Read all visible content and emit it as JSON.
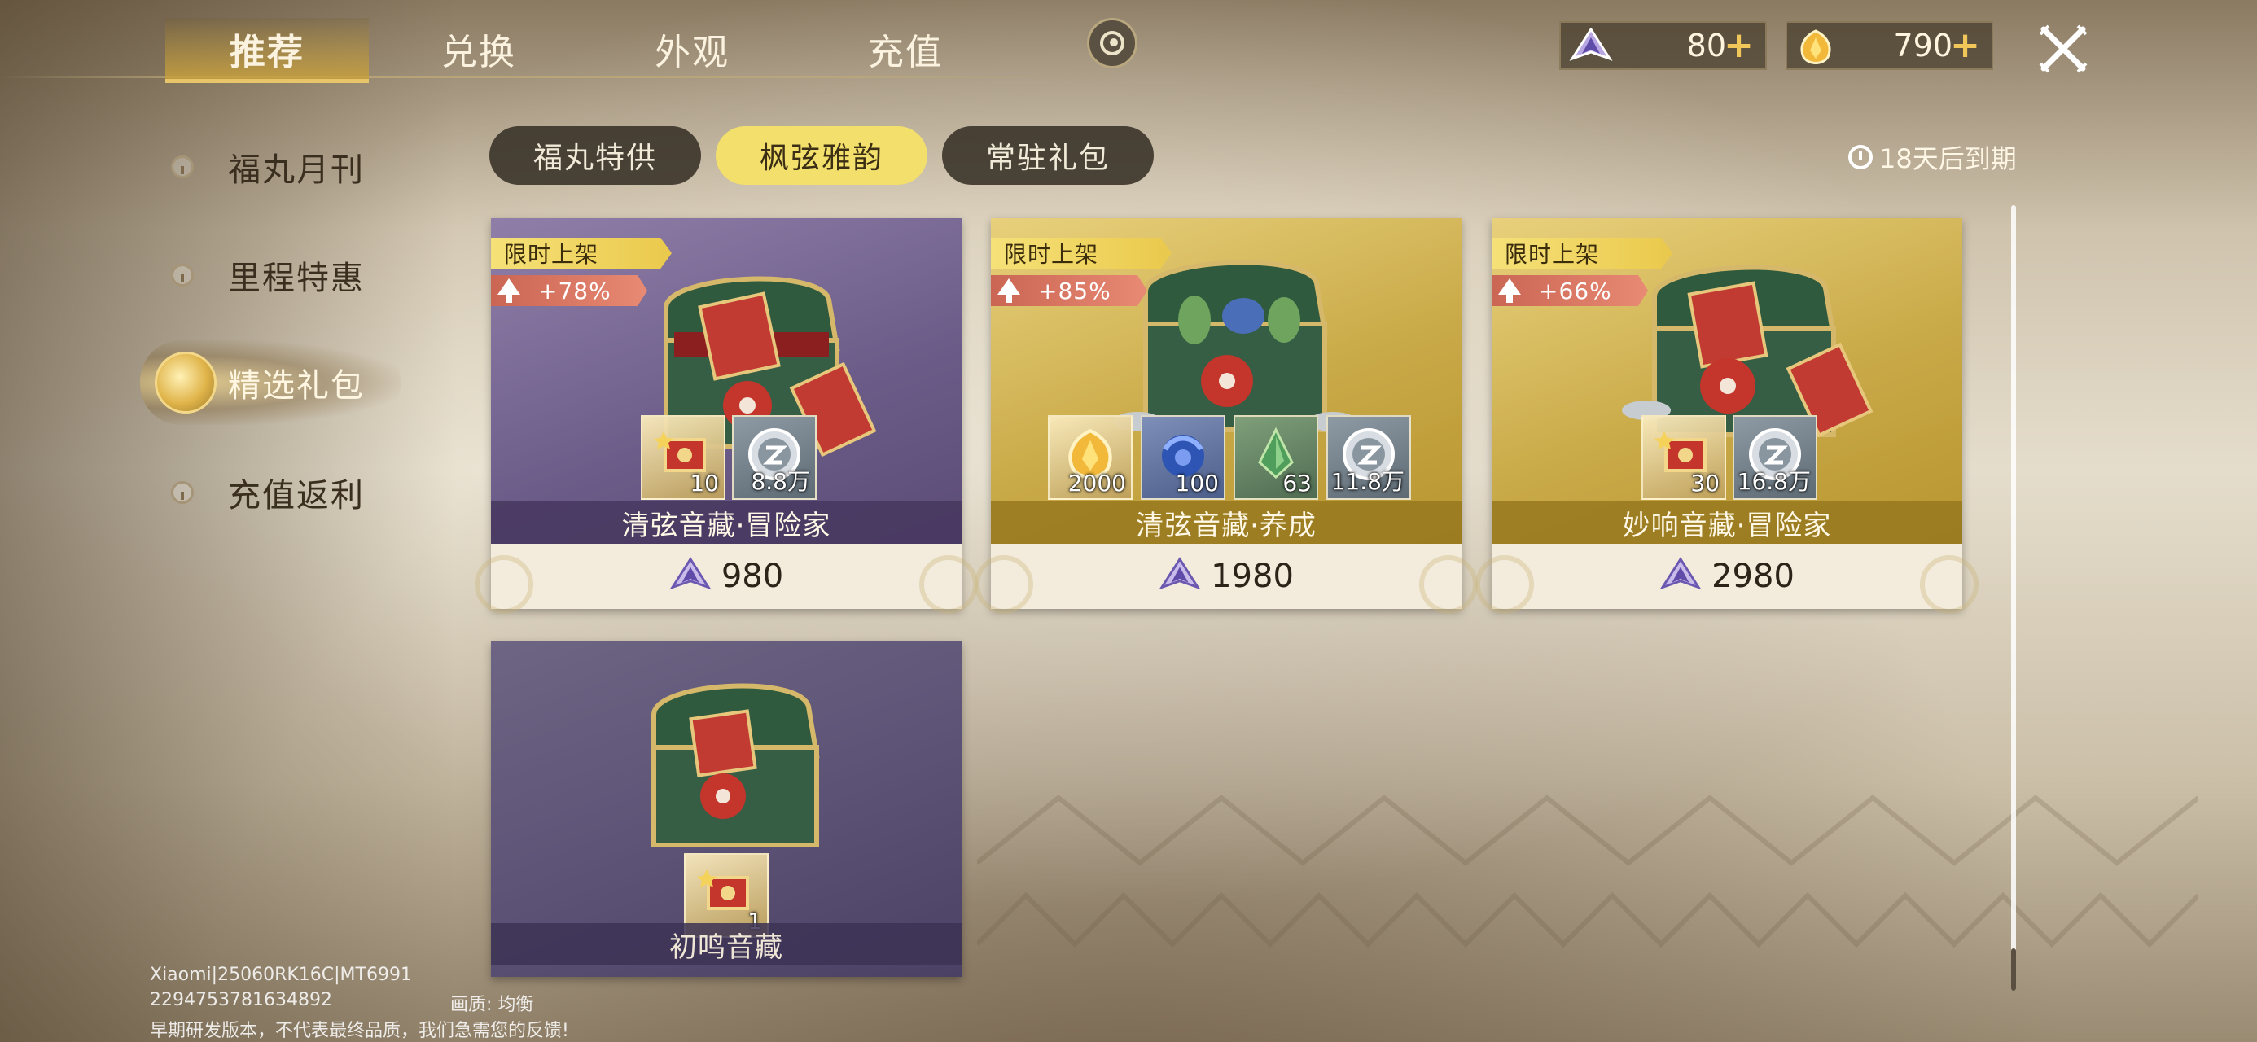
{
  "top_tabs": [
    "推荐",
    "兑换",
    "外观",
    "充值"
  ],
  "currency": {
    "gems": "80",
    "coins": "790",
    "plus_label": "+"
  },
  "sidebar": {
    "items": [
      {
        "label": "福丸月刊"
      },
      {
        "label": "里程特惠"
      },
      {
        "label": "精选礼包"
      },
      {
        "label": "充值返利"
      }
    ]
  },
  "subtabs": [
    "福丸特供",
    "枫弦雅韵",
    "常驻礼包"
  ],
  "expire_text": "18天后到期",
  "cards": [
    {
      "tag": "限时上架",
      "boost": "+78%",
      "name": "清弦音藏·冒险家",
      "price": "980",
      "items": [
        {
          "icon": "card-icon",
          "qty": "10"
        },
        {
          "icon": "coin-icon",
          "qty": "8.8万"
        }
      ]
    },
    {
      "tag": "限时上架",
      "boost": "+85%",
      "name": "清弦音藏·养成",
      "price": "1980",
      "items": [
        {
          "icon": "gold-crystal-icon",
          "qty": "2000"
        },
        {
          "icon": "blue-orb-icon",
          "qty": "100"
        },
        {
          "icon": "green-crystal-icon",
          "qty": "63"
        },
        {
          "icon": "coin-icon",
          "qty": "11.8万"
        }
      ]
    },
    {
      "tag": "限时上架",
      "boost": "+66%",
      "name": "妙响音藏·冒险家",
      "price": "2980",
      "items": [
        {
          "icon": "card-icon",
          "qty": "30"
        },
        {
          "icon": "coin-icon",
          "qty": "16.8万"
        }
      ]
    },
    {
      "name": "初鸣音藏",
      "items": [
        {
          "icon": "card-icon",
          "qty": "1"
        }
      ]
    }
  ],
  "footer": {
    "device": "Xiaomi|25060RK16C|MT6991",
    "id": "2294753781634892",
    "quality": "画质: 均衡",
    "notice": "早期研发版本，不代表最终品质，我们急需您的反馈!"
  },
  "colors": {
    "active_subtab": "#f2df6c",
    "accent_gold": "#e8c46a",
    "boost_red": "#d8705c"
  }
}
